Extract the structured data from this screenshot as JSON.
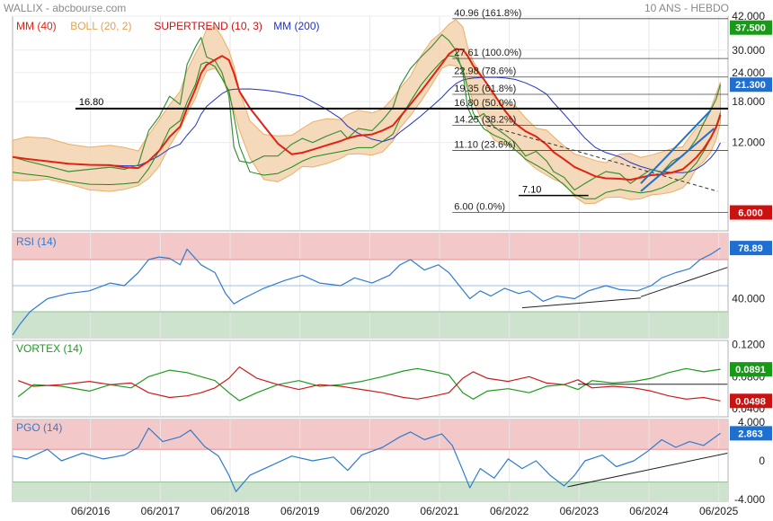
{
  "header": {
    "source": "WALLIX - abcbourse.com",
    "period": "10 ANS - HEBDO"
  },
  "colors": {
    "mm40": "#e32213",
    "boll_line": "#e8a14b",
    "boll_fill": "#f3d4b0",
    "supertrend": "#1a8a1a",
    "supertrend_alt": "#cc1111",
    "mm200": "#2233c8",
    "price_up": "#2a9a2a",
    "price_down": "#c42418",
    "accent_blue": "#1f6fd0",
    "overbought_zone": "#f3c8c8",
    "oversold_zone": "#cde3cd",
    "rsi_line": "#2f7bd1",
    "vortex_plus": "#1f9b1f",
    "vortex_minus": "#cc1b1b",
    "pgo_line": "#2f7bd1",
    "badge_blue": "#1f6fd0",
    "badge_green": "#189a18",
    "badge_red": "#cc1111"
  },
  "chart_data": [
    {
      "panel": "price",
      "type": "line",
      "scale": "log",
      "legend": [
        {
          "label": "MM (40)",
          "color": "#e32213"
        },
        {
          "label": "BOLL (20, 2)",
          "color": "#e8a14b"
        },
        {
          "label": "SUPERTREND (10, 3)",
          "color": "#cc1111"
        },
        {
          "label": "MM (200)",
          "color": "#2233c8"
        }
      ],
      "yticks": [
        "42.000",
        "30.000",
        "24.000",
        "18.000",
        "12.000"
      ],
      "xticks": [
        "06/2016",
        "06/2017",
        "06/2018",
        "06/2019",
        "06/2020",
        "06/2021",
        "06/2022",
        "06/2023",
        "06/2024",
        "06/2025"
      ],
      "ylim": [
        5,
        42
      ],
      "x_range": [
        2015.3,
        2025.55
      ],
      "series_price": [
        [
          2015.3,
          10.4
        ],
        [
          2015.5,
          10.0
        ],
        [
          2015.8,
          9.5
        ],
        [
          2016.1,
          9.0
        ],
        [
          2016.4,
          9.2
        ],
        [
          2016.7,
          9.4
        ],
        [
          2016.9,
          9.2
        ],
        [
          2017.1,
          9.6
        ],
        [
          2017.25,
          13.5
        ],
        [
          2017.4,
          15.5
        ],
        [
          2017.55,
          19.0
        ],
        [
          2017.7,
          17.5
        ],
        [
          2017.8,
          26.0
        ],
        [
          2017.92,
          31.0
        ],
        [
          2018.0,
          34.0
        ],
        [
          2018.08,
          28.0
        ],
        [
          2018.2,
          27.0
        ],
        [
          2018.3,
          24.0
        ],
        [
          2018.4,
          19.0
        ],
        [
          2018.47,
          11.5
        ],
        [
          2018.55,
          10.0
        ],
        [
          2018.7,
          9.8
        ],
        [
          2018.9,
          10.5
        ],
        [
          2019.1,
          10.5
        ],
        [
          2019.3,
          11.8
        ],
        [
          2019.45,
          12.5
        ],
        [
          2019.6,
          12.0
        ],
        [
          2019.8,
          12.8
        ],
        [
          2020.0,
          13.5
        ],
        [
          2020.1,
          12.5
        ],
        [
          2020.25,
          13.8
        ],
        [
          2020.45,
          13.5
        ],
        [
          2020.6,
          15.0
        ],
        [
          2020.75,
          17.0
        ],
        [
          2020.85,
          21.0
        ],
        [
          2021.0,
          25.0
        ],
        [
          2021.15,
          28.0
        ],
        [
          2021.3,
          31.0
        ],
        [
          2021.45,
          35.0
        ],
        [
          2021.55,
          33.0
        ],
        [
          2021.65,
          30.0
        ],
        [
          2021.75,
          24.0
        ],
        [
          2021.82,
          17.0
        ],
        [
          2021.9,
          15.0
        ],
        [
          2022.05,
          16.0
        ],
        [
          2022.2,
          14.0
        ],
        [
          2022.35,
          13.0
        ],
        [
          2022.5,
          12.0
        ],
        [
          2022.65,
          10.5
        ],
        [
          2022.8,
          11.0
        ],
        [
          2022.95,
          10.0
        ],
        [
          2023.05,
          9.0
        ],
        [
          2023.2,
          8.5
        ],
        [
          2023.35,
          7.5
        ],
        [
          2023.5,
          8.0
        ],
        [
          2023.65,
          8.5
        ],
        [
          2023.8,
          9.0
        ],
        [
          2024.0,
          8.8
        ],
        [
          2024.15,
          8.0
        ],
        [
          2024.3,
          8.6
        ],
        [
          2024.45,
          9.2
        ],
        [
          2024.6,
          8.9
        ],
        [
          2024.75,
          10.0
        ],
        [
          2024.9,
          10.5
        ],
        [
          2025.0,
          11.3
        ],
        [
          2025.1,
          12.5
        ],
        [
          2025.2,
          14.5
        ],
        [
          2025.3,
          16.5
        ],
        [
          2025.38,
          18.5
        ],
        [
          2025.44,
          21.3
        ]
      ],
      "annotations": {
        "resistance": {
          "label": "16.80",
          "value": 16.8
        },
        "support_low": {
          "label": "7.10",
          "value": 7.1
        },
        "fibonacci": [
          {
            "label": "40.96  (161.8%)",
            "value": 40.96
          },
          {
            "label": "27.61  (100.0%)",
            "value": 27.61
          },
          {
            "label": "22.98  (78.6%)",
            "value": 22.98
          },
          {
            "label": "19.35  (61.8%)",
            "value": 19.35
          },
          {
            "label": "16.80  (50.0%)",
            "value": 16.8
          },
          {
            "label": "14.25  (38.2%)",
            "value": 14.25
          },
          {
            "label": "11.10  (23.6%)",
            "value": 11.1
          },
          {
            "label": "6.00  (0.0%)",
            "value": 6.0
          }
        ]
      },
      "badges": [
        {
          "text": "37.500",
          "value": 37.5,
          "color": "#189a18"
        },
        {
          "text": "21.300",
          "value": 21.3,
          "color": "#1f6fd0"
        },
        {
          "text": "6.000",
          "value": 6.0,
          "color": "#cc1111"
        }
      ]
    },
    {
      "panel": "rsi",
      "type": "line",
      "legend": "RSI (14)",
      "ylim": [
        10,
        90
      ],
      "yticks": [
        "40.000"
      ],
      "zones": {
        "overbought": 70,
        "oversold": 30,
        "mid": 50
      },
      "series": [
        [
          2015.3,
          12
        ],
        [
          2015.4,
          20
        ],
        [
          2015.55,
          30
        ],
        [
          2015.8,
          40
        ],
        [
          2016.1,
          44
        ],
        [
          2016.4,
          46
        ],
        [
          2016.7,
          52
        ],
        [
          2016.9,
          50
        ],
        [
          2017.1,
          60
        ],
        [
          2017.25,
          70
        ],
        [
          2017.4,
          72
        ],
        [
          2017.55,
          71
        ],
        [
          2017.7,
          66
        ],
        [
          2017.8,
          78
        ],
        [
          2018.0,
          66
        ],
        [
          2018.2,
          60
        ],
        [
          2018.35,
          44
        ],
        [
          2018.47,
          36
        ],
        [
          2018.6,
          40
        ],
        [
          2018.9,
          48
        ],
        [
          2019.2,
          54
        ],
        [
          2019.45,
          58
        ],
        [
          2019.7,
          52
        ],
        [
          2020.0,
          50
        ],
        [
          2020.2,
          56
        ],
        [
          2020.45,
          52
        ],
        [
          2020.7,
          58
        ],
        [
          2020.85,
          66
        ],
        [
          2021.0,
          70
        ],
        [
          2021.2,
          62
        ],
        [
          2021.4,
          66
        ],
        [
          2021.55,
          60
        ],
        [
          2021.7,
          50
        ],
        [
          2021.85,
          40
        ],
        [
          2022.0,
          46
        ],
        [
          2022.15,
          42
        ],
        [
          2022.35,
          48
        ],
        [
          2022.55,
          44
        ],
        [
          2022.7,
          46
        ],
        [
          2022.9,
          38
        ],
        [
          2023.1,
          42
        ],
        [
          2023.35,
          40
        ],
        [
          2023.55,
          46
        ],
        [
          2023.8,
          50
        ],
        [
          2024.0,
          47
        ],
        [
          2024.25,
          46
        ],
        [
          2024.45,
          50
        ],
        [
          2024.6,
          56
        ],
        [
          2024.8,
          60
        ],
        [
          2025.0,
          63
        ],
        [
          2025.15,
          70
        ],
        [
          2025.3,
          74
        ],
        [
          2025.44,
          78.89
        ]
      ],
      "trendline": [
        [
          2022.6,
          33
        ],
        [
          2024.3,
          40.5
        ]
      ],
      "trendline2": [
        [
          2024.3,
          41.5
        ],
        [
          2025.54,
          64
        ]
      ],
      "badge": {
        "text": "78.89",
        "value": 78.89,
        "color": "#1f6fd0"
      }
    },
    {
      "panel": "vortex",
      "type": "line",
      "legend": "VORTEX (14)",
      "ylim": [
        0.03,
        0.125
      ],
      "yticks": [
        "0.1200",
        "0.0800",
        "0.0400"
      ],
      "series": [
        {
          "name": "VI+",
          "color": "#1f9b1f",
          "values": [
            [
              2015.38,
              0.055
            ],
            [
              2015.6,
              0.07
            ],
            [
              2016.0,
              0.068
            ],
            [
              2016.4,
              0.062
            ],
            [
              2016.7,
              0.07
            ],
            [
              2017.0,
              0.066
            ],
            [
              2017.25,
              0.08
            ],
            [
              2017.55,
              0.088
            ],
            [
              2017.8,
              0.085
            ],
            [
              2018.0,
              0.08
            ],
            [
              2018.2,
              0.075
            ],
            [
              2018.4,
              0.06
            ],
            [
              2018.55,
              0.05
            ],
            [
              2018.8,
              0.06
            ],
            [
              2019.1,
              0.07
            ],
            [
              2019.4,
              0.075
            ],
            [
              2019.7,
              0.068
            ],
            [
              2020.0,
              0.07
            ],
            [
              2020.3,
              0.074
            ],
            [
              2020.6,
              0.08
            ],
            [
              2020.9,
              0.087
            ],
            [
              2021.1,
              0.09
            ],
            [
              2021.35,
              0.086
            ],
            [
              2021.55,
              0.082
            ],
            [
              2021.75,
              0.06
            ],
            [
              2021.9,
              0.052
            ],
            [
              2022.1,
              0.062
            ],
            [
              2022.4,
              0.065
            ],
            [
              2022.7,
              0.06
            ],
            [
              2022.95,
              0.068
            ],
            [
              2023.2,
              0.07
            ],
            [
              2023.4,
              0.064
            ],
            [
              2023.6,
              0.075
            ],
            [
              2023.9,
              0.072
            ],
            [
              2024.2,
              0.074
            ],
            [
              2024.45,
              0.078
            ],
            [
              2024.7,
              0.085
            ],
            [
              2024.95,
              0.09
            ],
            [
              2025.2,
              0.086
            ],
            [
              2025.44,
              0.0891
            ]
          ]
        },
        {
          "name": "VI-",
          "color": "#cc1b1b",
          "values": [
            [
              2015.38,
              0.075
            ],
            [
              2015.6,
              0.068
            ],
            [
              2016.0,
              0.07
            ],
            [
              2016.4,
              0.074
            ],
            [
              2016.7,
              0.07
            ],
            [
              2017.0,
              0.072
            ],
            [
              2017.25,
              0.06
            ],
            [
              2017.55,
              0.054
            ],
            [
              2017.8,
              0.056
            ],
            [
              2018.0,
              0.06
            ],
            [
              2018.2,
              0.066
            ],
            [
              2018.4,
              0.078
            ],
            [
              2018.55,
              0.092
            ],
            [
              2018.8,
              0.078
            ],
            [
              2019.1,
              0.07
            ],
            [
              2019.4,
              0.064
            ],
            [
              2019.7,
              0.07
            ],
            [
              2020.0,
              0.068
            ],
            [
              2020.3,
              0.064
            ],
            [
              2020.6,
              0.06
            ],
            [
              2020.9,
              0.054
            ],
            [
              2021.1,
              0.052
            ],
            [
              2021.35,
              0.056
            ],
            [
              2021.55,
              0.06
            ],
            [
              2021.75,
              0.078
            ],
            [
              2021.9,
              0.086
            ],
            [
              2022.1,
              0.078
            ],
            [
              2022.4,
              0.074
            ],
            [
              2022.7,
              0.08
            ],
            [
              2022.95,
              0.072
            ],
            [
              2023.2,
              0.07
            ],
            [
              2023.4,
              0.076
            ],
            [
              2023.6,
              0.066
            ],
            [
              2023.9,
              0.068
            ],
            [
              2024.2,
              0.066
            ],
            [
              2024.45,
              0.062
            ],
            [
              2024.7,
              0.056
            ],
            [
              2024.95,
              0.052
            ],
            [
              2025.2,
              0.054
            ],
            [
              2025.44,
              0.0498
            ]
          ]
        }
      ],
      "trendline": [
        [
          2023.4,
          0.0705
        ],
        [
          2025.54,
          0.0705
        ]
      ],
      "badges": [
        {
          "text": "0.0891",
          "value": 0.0891,
          "color": "#189a18"
        },
        {
          "text": "0.0498",
          "value": 0.0498,
          "color": "#cc1111"
        }
      ]
    },
    {
      "panel": "pgo",
      "type": "line",
      "legend": "PGO (14)",
      "ylim": [
        -4.2,
        4.3
      ],
      "yticks": [
        "4.000",
        "0",
        "-4.000"
      ],
      "zones": {
        "overbought": 1.2,
        "oversold": -2.2
      },
      "series": [
        [
          2015.3,
          0.5
        ],
        [
          2015.5,
          0.2
        ],
        [
          2015.8,
          1.2
        ],
        [
          2016.0,
          0.0
        ],
        [
          2016.3,
          0.8
        ],
        [
          2016.6,
          0.2
        ],
        [
          2016.9,
          0.6
        ],
        [
          2017.1,
          1.4
        ],
        [
          2017.25,
          3.4
        ],
        [
          2017.45,
          2.0
        ],
        [
          2017.7,
          2.5
        ],
        [
          2017.85,
          3.2
        ],
        [
          2018.05,
          1.5
        ],
        [
          2018.25,
          0.5
        ],
        [
          2018.4,
          -1.5
        ],
        [
          2018.5,
          -3.2
        ],
        [
          2018.7,
          -1.5
        ],
        [
          2019.0,
          -0.5
        ],
        [
          2019.3,
          0.5
        ],
        [
          2019.6,
          0.0
        ],
        [
          2019.9,
          0.4
        ],
        [
          2020.1,
          -1.0
        ],
        [
          2020.3,
          0.6
        ],
        [
          2020.6,
          1.4
        ],
        [
          2020.85,
          2.5
        ],
        [
          2021.0,
          3.0
        ],
        [
          2021.2,
          2.2
        ],
        [
          2021.45,
          2.8
        ],
        [
          2021.6,
          1.6
        ],
        [
          2021.75,
          -1.0
        ],
        [
          2021.85,
          -2.8
        ],
        [
          2022.0,
          -0.8
        ],
        [
          2022.2,
          -1.8
        ],
        [
          2022.4,
          0.2
        ],
        [
          2022.6,
          -0.8
        ],
        [
          2022.8,
          0.0
        ],
        [
          2023.0,
          -1.5
        ],
        [
          2023.2,
          -2.6
        ],
        [
          2023.35,
          -1.5
        ],
        [
          2023.5,
          0.0
        ],
        [
          2023.75,
          0.6
        ],
        [
          2023.95,
          -0.6
        ],
        [
          2024.2,
          0.0
        ],
        [
          2024.4,
          1.0
        ],
        [
          2024.6,
          2.2
        ],
        [
          2024.8,
          1.4
        ],
        [
          2025.0,
          2.0
        ],
        [
          2025.2,
          1.6
        ],
        [
          2025.44,
          2.863
        ]
      ],
      "trendline": [
        [
          2023.25,
          -2.7
        ],
        [
          2025.54,
          0.8
        ]
      ],
      "badge": {
        "text": "2.863",
        "value": 2.863,
        "color": "#1f6fd0"
      }
    }
  ]
}
